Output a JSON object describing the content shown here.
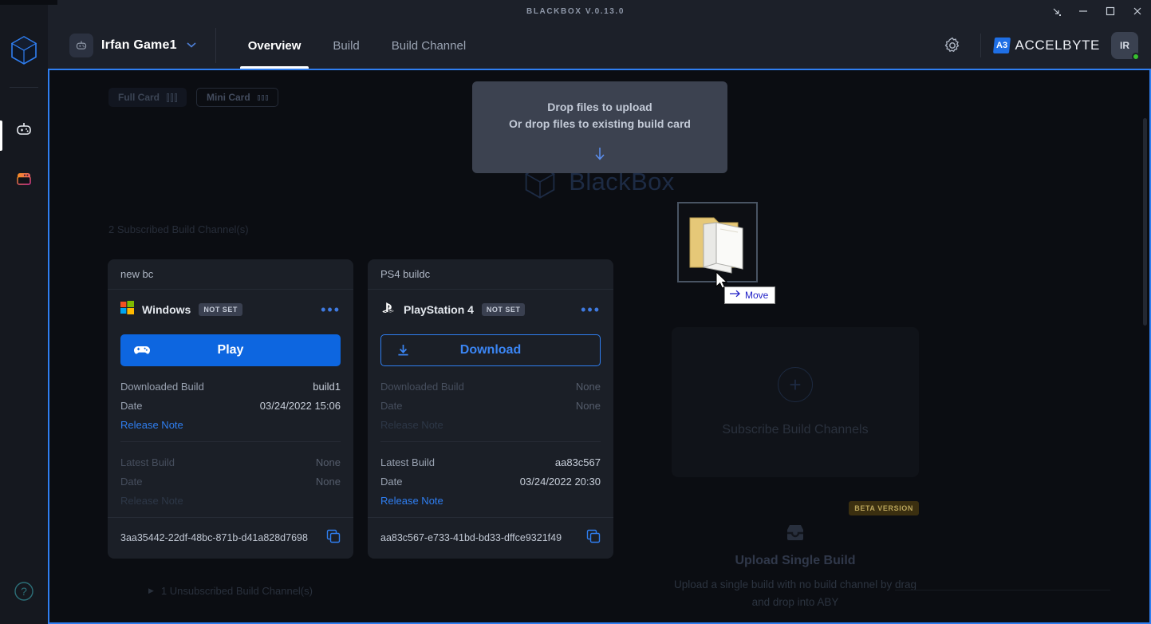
{
  "titlebar": {
    "title": "BLACKBOX V.0.13.0",
    "restore_down": "restore-down",
    "minimize": "minimize",
    "maximize": "maximize",
    "close": "close"
  },
  "header": {
    "game_icon": "gamepad-icon",
    "game_name": "Irfan Game1",
    "caret": "▼",
    "tabs": [
      {
        "label": "Overview",
        "active": true
      },
      {
        "label": "Build",
        "active": false
      },
      {
        "label": "Build Channel",
        "active": false
      }
    ],
    "settings_icon": "gear-icon",
    "brand_mark": "A3",
    "brand_name": "ACCELBYTE",
    "avatar_initials": "IR",
    "status": "online"
  },
  "rail": {
    "logo": "blackbox-cube-logo",
    "items": [
      {
        "icon": "gamepad-icon",
        "name": "games"
      },
      {
        "icon": "window-icon",
        "name": "launcher"
      }
    ],
    "help_icon": "help-circle-icon"
  },
  "main": {
    "watermark": "BlackBox",
    "card_modes": [
      {
        "label": "Full Card",
        "active": true
      },
      {
        "label": "Mini Card",
        "active": false
      }
    ],
    "dropzone": {
      "line1": "Drop files to upload",
      "line2": "Or drop files to existing build card",
      "arrow": "↓"
    },
    "subscribed_label": "2 Subscribed Build Channel(s)",
    "unsubscribed_label": "1 Unsubscribed Build Channel(s)",
    "cards": [
      {
        "channel": "new bc",
        "platform": "Windows",
        "platform_icon": "windows-icon",
        "badge": "NOT SET",
        "menu": "•••",
        "action": {
          "label": "Play",
          "icon": "gamepad-icon",
          "style": "primary"
        },
        "downloaded": {
          "k1": "Downloaded Build",
          "v1": "build1",
          "k2": "Date",
          "v2": "03/24/2022 15:06",
          "k3": "Release Note",
          "dim": false
        },
        "latest": {
          "k1": "Latest Build",
          "v1": "None",
          "k2": "Date",
          "v2": "None",
          "k3": "Release Note",
          "dim": true
        },
        "id": "3aa35442-22df-48bc-871b-d41a828d7698",
        "copy_icon": "copy-icon"
      },
      {
        "channel": "PS4 buildc",
        "platform": "PlayStation 4",
        "platform_icon": "playstation-icon",
        "badge": "NOT SET",
        "menu": "•••",
        "action": {
          "label": "Download",
          "icon": "download-icon",
          "style": "outline"
        },
        "downloaded": {
          "k1": "Downloaded Build",
          "v1": "None",
          "k2": "Date",
          "v2": "None",
          "k3": "Release Note",
          "dim": true
        },
        "latest": {
          "k1": "Latest Build",
          "v1": "aa83c567",
          "k2": "Date",
          "v2": "03/24/2022 20:30",
          "k3": "Release Note",
          "dim": false
        },
        "id": "aa83c567-e733-41bd-bd33-dffce9321f49",
        "copy_icon": "copy-icon"
      }
    ],
    "subscribe_panel": {
      "plus": "+",
      "label": "Subscribe Build Channels"
    },
    "upload_single": {
      "beta": "BETA VERSION",
      "icon": "inbox-icon",
      "title": "Upload Single Build",
      "desc": "Upload a single build with no build channel by drag and drop into ABY"
    },
    "drag": {
      "ghost": "folder-drag-image",
      "cursor": "arrow-cursor",
      "tooltip_label": "Move",
      "tooltip_icon": "arrow-right-icon"
    }
  },
  "colors": {
    "accent_blue": "#2f7ef0",
    "primary_button": "#0d66e0",
    "background": "#0b0d12",
    "panel": "#1b1f27",
    "header": "#1c2029",
    "online": "#37c02e",
    "beta_badge_bg": "#3b2f10"
  }
}
